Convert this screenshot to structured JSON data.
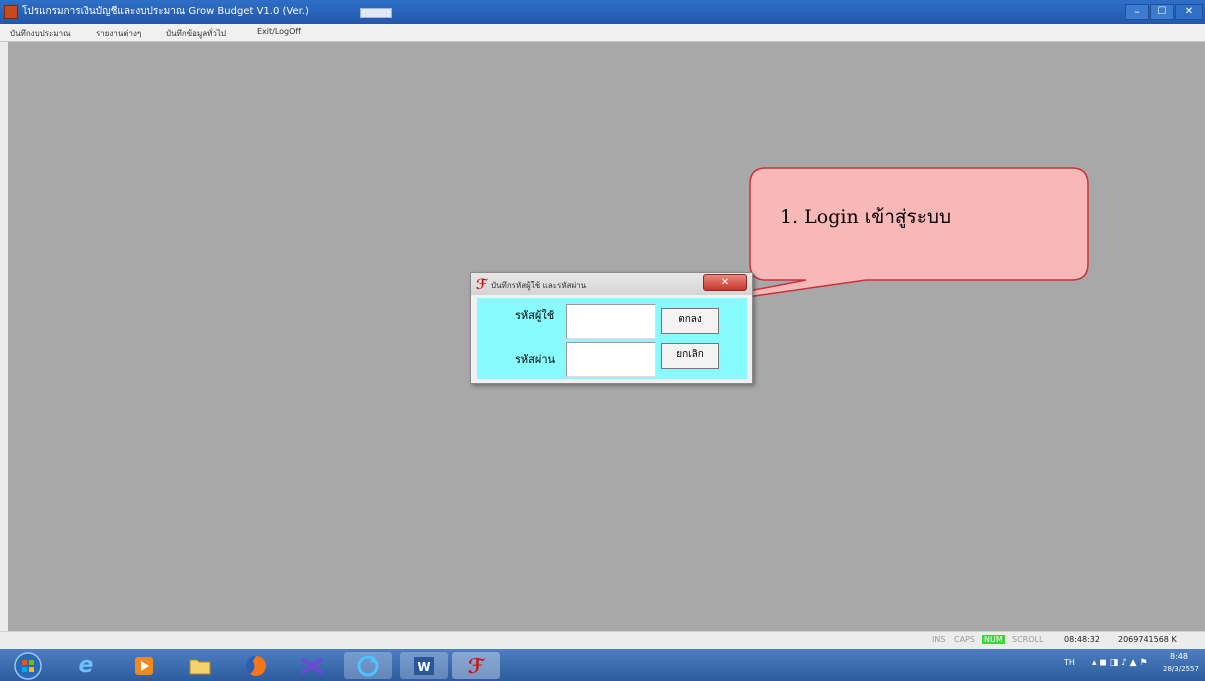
{
  "window": {
    "title": "โปรแกรมการเงินบัญชีและงบประมาณ Grow Budget V1.0 (Ver.)",
    "minimize": "–",
    "maximize": "☐",
    "close": "✕"
  },
  "menu": [
    "บันทึกงบประมาณ",
    "รายงานต่างๆ",
    "บันทึกข้อมูลทั่วไป",
    "Exit/LogOff"
  ],
  "dialog": {
    "title": "บันทึกรหัสผู้ใช้ และรหัสผ่าน",
    "close": "✕",
    "username_label": "รหัสผู้ใช้",
    "password_label": "รหัสผ่าน",
    "username_value": "",
    "password_value": "",
    "ok_label": "ตกลง",
    "cancel_label": "ยกเลิก"
  },
  "callout": {
    "text": "1. Login เข้าสู่ระบบ"
  },
  "statusbar": {
    "ins": "INS",
    "caps": "CAPS",
    "num": "NUM",
    "scroll": "SCROLL",
    "time": "08:48:32",
    "memory": "2069741568 K"
  },
  "taskbar": {
    "lang": "TH",
    "clock_time": "8:48",
    "clock_date": "28/3/2557"
  },
  "colors": {
    "dialog_body": "#88fbff",
    "callout_fill": "#f8b8b8",
    "callout_stroke": "#c8323a",
    "num_indicator": "#3bd43b"
  }
}
